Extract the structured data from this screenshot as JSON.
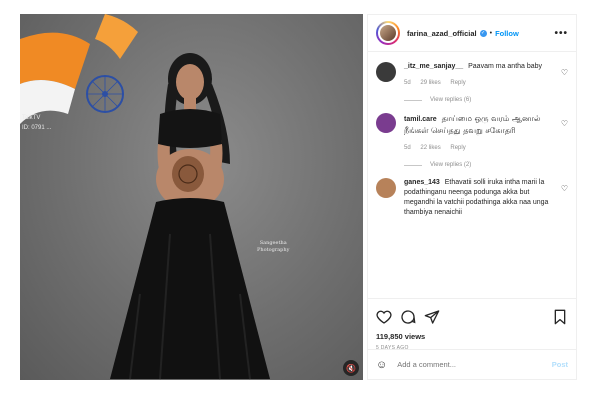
{
  "post": {
    "username": "farina_azad_official",
    "follow_label": "Follow",
    "separator": "•",
    "more": "•••",
    "views": "119,850 views",
    "time_ago": "5 DAYS AGO"
  },
  "photo": {
    "overlay_line1": "TalkTV",
    "overlay_line2": "ID: 0791 ...",
    "watermark_line1": "Sangeetha",
    "watermark_line2": "Photography"
  },
  "comments": [
    {
      "user": "_itz_me_sanjay__",
      "text": "Paavam ma antha baby",
      "time": "5d",
      "likes": "29 likes",
      "reply": "Reply",
      "view_replies": "View replies (6)",
      "avatar_color": "#3a3a3a"
    },
    {
      "user": "tamil.care",
      "text": "தாய்மை ஒரு வரம் ஆனால் நீங்கள் செய்தது தவறு சகோதரி",
      "time": "5d",
      "likes": "22 likes",
      "reply": "Reply",
      "view_replies": "View replies (2)",
      "avatar_color": "#7a3c8f"
    },
    {
      "user": "ganes_143",
      "text": "Ethavatii solli iruka intha marii la podathinganu neenga podunga akka but megandhi la vatchii podathinga akka naa unga thambiya nenaichii",
      "avatar_color": "#b7825a"
    }
  ],
  "add_comment": {
    "placeholder": "Add a comment...",
    "post_label": "Post"
  },
  "colors": {
    "follow": "#0095f6",
    "post_disabled": "#b2dffc",
    "muted_text": "#8e8e8e"
  },
  "icons": [
    "heart-icon",
    "comment-icon",
    "share-icon",
    "bookmark-icon",
    "emoji-icon",
    "mute-icon",
    "more-icon",
    "verified-icon"
  ]
}
